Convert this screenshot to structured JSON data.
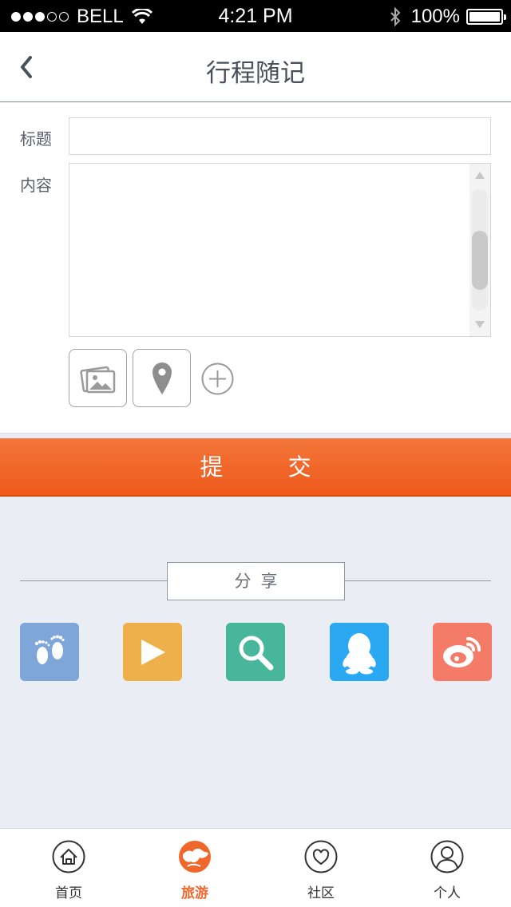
{
  "status": {
    "carrier": "BELL",
    "time": "4:21 PM",
    "battery": "100%"
  },
  "nav": {
    "title": "行程随记"
  },
  "form": {
    "title_label": "标题",
    "title_value": "",
    "content_label": "内容",
    "content_value": ""
  },
  "submit": {
    "label": "提 交"
  },
  "share": {
    "label": "分享",
    "items": [
      {
        "icon": "footprints-icon",
        "color": "#7ea6d9"
      },
      {
        "icon": "play-icon",
        "color": "#eeb04b"
      },
      {
        "icon": "search-icon",
        "color": "#48b69b"
      },
      {
        "icon": "qq-icon",
        "color": "#2aa8f1"
      },
      {
        "icon": "weibo-icon",
        "color": "#f37b68"
      }
    ]
  },
  "tabbar": {
    "items": [
      {
        "label": "首页",
        "icon": "home-icon"
      },
      {
        "label": "旅游",
        "icon": "travel-icon",
        "active": true
      },
      {
        "label": "社区",
        "icon": "heart-icon"
      },
      {
        "label": "个人",
        "icon": "person-icon"
      }
    ]
  },
  "colors": {
    "accent": "#f0672b",
    "background": "#ebedf5"
  }
}
